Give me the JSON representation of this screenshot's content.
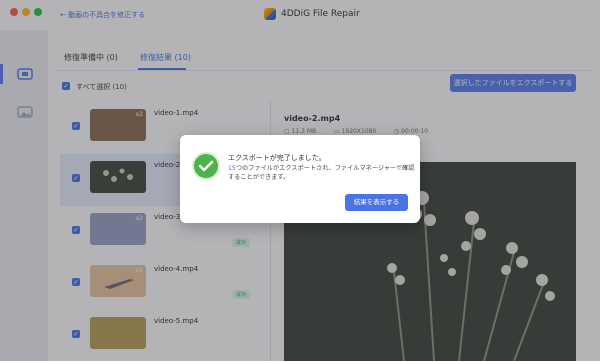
{
  "titlebar": {
    "back_label": "動画の不具合を修正する",
    "app_title": "4DDiG File Repair"
  },
  "tabs": [
    {
      "label": "修復準備中 (0)"
    },
    {
      "label": "修復結果 (10)"
    }
  ],
  "list_header": {
    "select_all_label": "すべて選択 (10)",
    "export_selected_label": "選択したファイルをエクスポートする"
  },
  "files": [
    {
      "name": "video-1.mp4",
      "badge": "x2",
      "thumb_color": "#8b6f55",
      "status": ""
    },
    {
      "name": "video-2.mp4",
      "badge": "",
      "thumb_color": "#444a3c",
      "status": ""
    },
    {
      "name": "video-3.mp4",
      "badge": "x2",
      "thumb_color": "#9aa3c7",
      "status": "成功"
    },
    {
      "name": "video-4.mp4",
      "badge": "x2",
      "thumb_color": "#e8c7a0",
      "status": "成功"
    },
    {
      "name": "video-5.mp4",
      "badge": "",
      "thumb_color": "#b9a25a",
      "status": ""
    }
  ],
  "preview": {
    "title": "video-2.mp4",
    "size": "11.3 MB",
    "resolution": "1920X1080",
    "duration": "00:00:10"
  },
  "dialog": {
    "title": "エクスポートが完了しました。",
    "count": "15",
    "body_rest": "つのファイルがエクスポートされ、ファイルマネージャーで確認することができます。",
    "button_label": "結果を表示する"
  },
  "colors": {
    "accent": "#4a73e6",
    "success": "#4fb24a",
    "overlay": "rgba(40,40,50,0.35)"
  }
}
